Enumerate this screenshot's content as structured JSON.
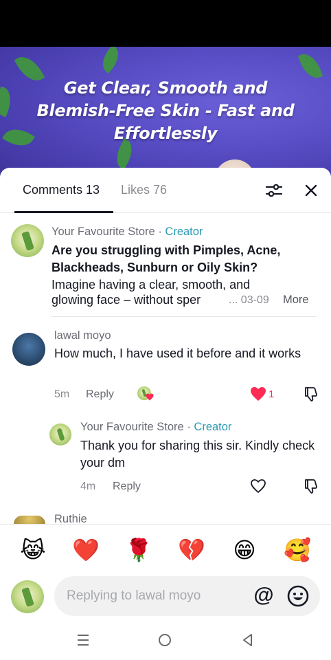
{
  "hero": {
    "text": "Get Clear, Smooth and Blemish-Free Skin - Fast and Effortlessly"
  },
  "tabs": {
    "comments_label": "Comments 13",
    "likes_label": "Likes 76"
  },
  "comments": [
    {
      "author": "Your Favourite Store",
      "separator": " · ",
      "badge": "Creator",
      "headline": "Are you struggling with Pimples, Acne, Blackheads, Sunburn or Oily Skin?",
      "body_line1": "Imagine having a clear, smooth, and",
      "body_line2": "glowing face – without sper",
      "ellipsis": "...",
      "date": "03-09",
      "more_label": "More"
    },
    {
      "author": "lawal moyo",
      "text": "How much, I have used it before and it works",
      "time": "5m",
      "reply_label": "Reply",
      "likes": "1",
      "liked": true,
      "reply": {
        "author": "Your Favourite Store",
        "separator": " · ",
        "badge": "Creator",
        "text": "Thank you for sharing this sir. Kindly check your dm",
        "time": "4m",
        "reply_label": "Reply"
      }
    },
    {
      "author": "Ruthie"
    }
  ],
  "emojis": [
    "😹",
    "❤️",
    "🌹",
    "💔",
    "😁",
    "🥰"
  ],
  "input": {
    "placeholder": "Replying to lawal moyo",
    "at_symbol": "@"
  },
  "colors": {
    "accent_like": "#fe2c55",
    "creator_badge": "#2b9ab5",
    "text_primary": "#161823",
    "text_secondary": "#8a8b91"
  },
  "icons": [
    "filter-icon",
    "close-icon",
    "heart-icon",
    "dislike-icon",
    "smile-icon",
    "menu-icon",
    "home-circle-icon",
    "back-triangle-icon"
  ]
}
